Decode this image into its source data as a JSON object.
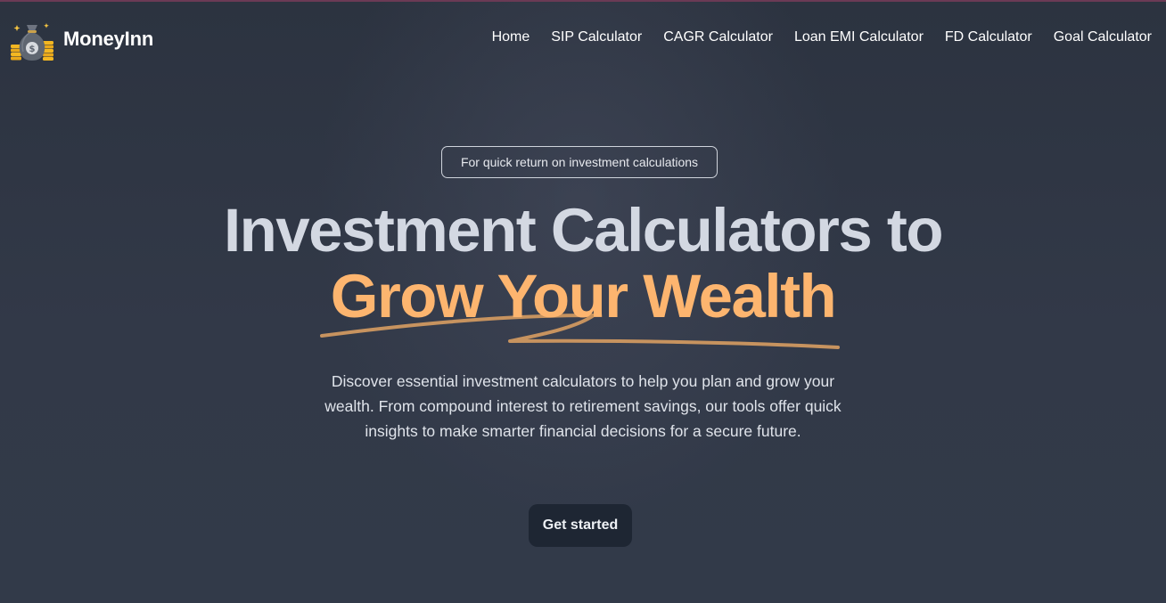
{
  "brand": {
    "name": "MoneyInn",
    "logo_icon": "money-bag-icon"
  },
  "nav": {
    "items": [
      {
        "label": "Home"
      },
      {
        "label": "SIP Calculator"
      },
      {
        "label": "CAGR Calculator"
      },
      {
        "label": "Loan EMI Calculator"
      },
      {
        "label": "FD Calculator"
      },
      {
        "label": "Goal Calculator"
      }
    ]
  },
  "hero": {
    "badge": "For quick return on investment calculations",
    "title_line1": "Investment Calculators to",
    "title_line2": "Grow Your Wealth",
    "description": "Discover essential investment calculators to help you plan and grow your wealth. From compound interest to retirement savings, our tools offer quick insights to make smarter financial decisions for a secure future.",
    "cta_label": "Get started"
  },
  "colors": {
    "accent": "#fdb56f",
    "underline": "#c7935f",
    "heading": "#d3d8e2",
    "background": "#323948",
    "button": "#1e2633"
  }
}
